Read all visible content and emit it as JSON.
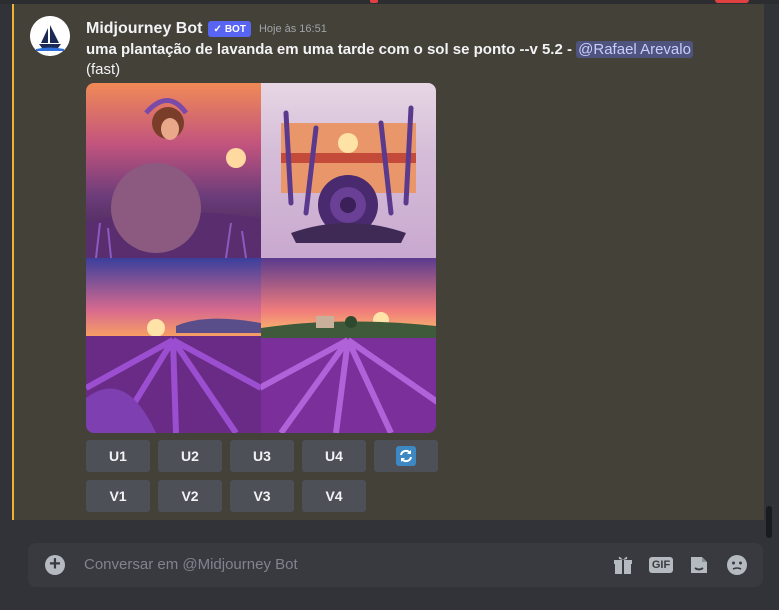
{
  "message": {
    "username": "Midjourney Bot",
    "bot_tag": "BOT",
    "bot_check": "✓",
    "timestamp": "Hoje às 16:51",
    "prompt": "uma plantação de lavanda em uma tarde com o sol se ponto --v 5.2",
    "separator": " - ",
    "mention": "@Rafael Arevalo",
    "mode": "(fast)",
    "accent_color": "#f0b232"
  },
  "image_grid": {
    "tiles": [
      "woman in lavanda field at sunset",
      "lavender rose bouquet with sunset",
      "lavender field rows at sunset",
      "lavender field with house on hill"
    ]
  },
  "buttons": {
    "row1": [
      "U1",
      "U2",
      "U3",
      "U4"
    ],
    "reroll_icon": "refresh-icon",
    "row2": [
      "V1",
      "V2",
      "V3",
      "V4"
    ]
  },
  "composer": {
    "placeholder": "Conversar em @Midjourney Bot",
    "icons": [
      "gift-icon",
      "gif-icon",
      "sticker-icon",
      "emoji-icon"
    ],
    "gif_label": "GIF"
  }
}
